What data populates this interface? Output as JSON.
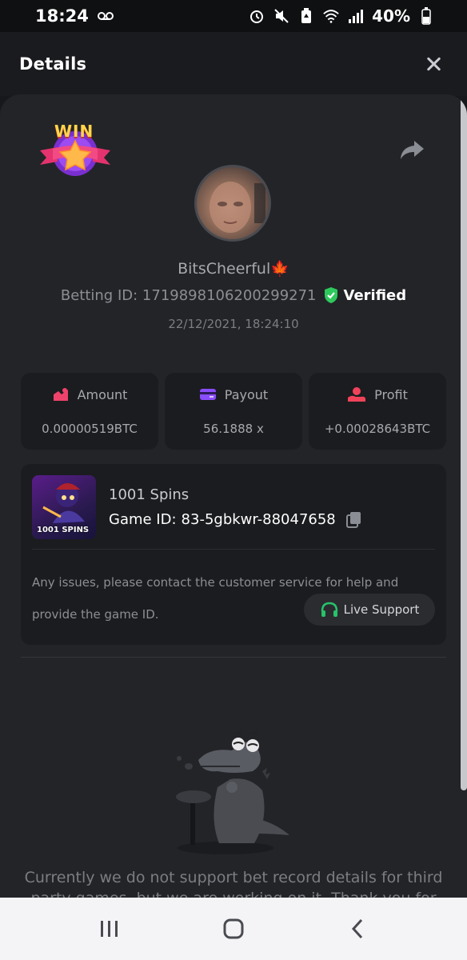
{
  "status_bar": {
    "time": "18:24",
    "battery": "40%"
  },
  "header": {
    "title": "Details"
  },
  "badge": {
    "text": "WIN"
  },
  "user": {
    "name": "BitsCheerful",
    "betting_label": "Betting ID: 1719898106200299271",
    "verified_label": "Verified",
    "timestamp": "22/12/2021, 18:24:10"
  },
  "stats": [
    {
      "label": "Amount",
      "value": "0.00000519BTC",
      "icon": "amount-icon",
      "color": "#f0436b"
    },
    {
      "label": "Payout",
      "value": "56.1888 x",
      "icon": "payout-icon",
      "color": "#8a4dfa"
    },
    {
      "label": "Profit",
      "value": "+0.00028643BTC",
      "icon": "profit-icon",
      "color": "#f0435a"
    }
  ],
  "game": {
    "name": "1001 Spins",
    "id_label": "Game ID:",
    "id_value": "83-5gbkwr-88047658",
    "thumb_text": "1001 SPINS",
    "help_text": "Any issues, please contact the customer service for help and provide the game ID.",
    "live_support_label": "Live Support"
  },
  "notice": "Currently we do not support bet record details for third party games, but we are working on it. Thank you for",
  "colors": {
    "verified": "#2ec95c",
    "live_support": "#27c26a"
  }
}
